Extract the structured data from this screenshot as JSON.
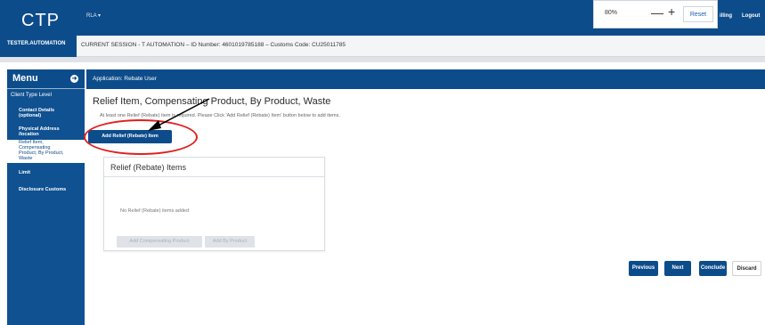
{
  "header": {
    "brand": "CTP",
    "user": "TESTER.AUTOMATION",
    "app_dropdown": "RLA ▾",
    "zoom": {
      "level": "80%",
      "minus": "—",
      "plus": "+",
      "reset": "Reset"
    },
    "billing": "illing",
    "logout": "Logout"
  },
  "session": {
    "text": "CURRENT SESSION - T AUTOMATION – ID Number: 4601019785188 – Customs Code: CU25011785"
  },
  "menu": {
    "label": "Menu",
    "toggle_icon": "circle-arrow-icon",
    "application_label": "Application: Rebate User"
  },
  "sidebar": {
    "section": "Client Type Level",
    "items": [
      {
        "line1": "Contact Details",
        "line2": "(optional)"
      },
      {
        "line1": "Physical Address",
        "line2": "/location"
      },
      {
        "line1": "Relief Item,",
        "line2": "Compensating",
        "line3": "Product, By Product,",
        "line4": "Waste"
      },
      {
        "line1": "Limit"
      },
      {
        "line1": "Disclosure Customs"
      }
    ]
  },
  "main": {
    "title": "Relief Item, Compensating Product, By Product, Waste",
    "hint": "At least one Relief (Rebate) item is required. Please Click 'Add Relief (Rebate) Item' button below to add items.",
    "add_button": "Add Relief (Rebate) Item",
    "card": {
      "title": "Relief (Rebate) Items",
      "empty": "No Relief (Rebate) items added",
      "btn_compensating": "Add Compensating Product",
      "btn_by_product": "Add By Product"
    },
    "nav": {
      "previous": "Previous",
      "next": "Next",
      "conclude": "Conclude",
      "discard": "Discard"
    }
  },
  "colors": {
    "brand": "#0d4c8b",
    "annotation": "#e01f1f"
  }
}
